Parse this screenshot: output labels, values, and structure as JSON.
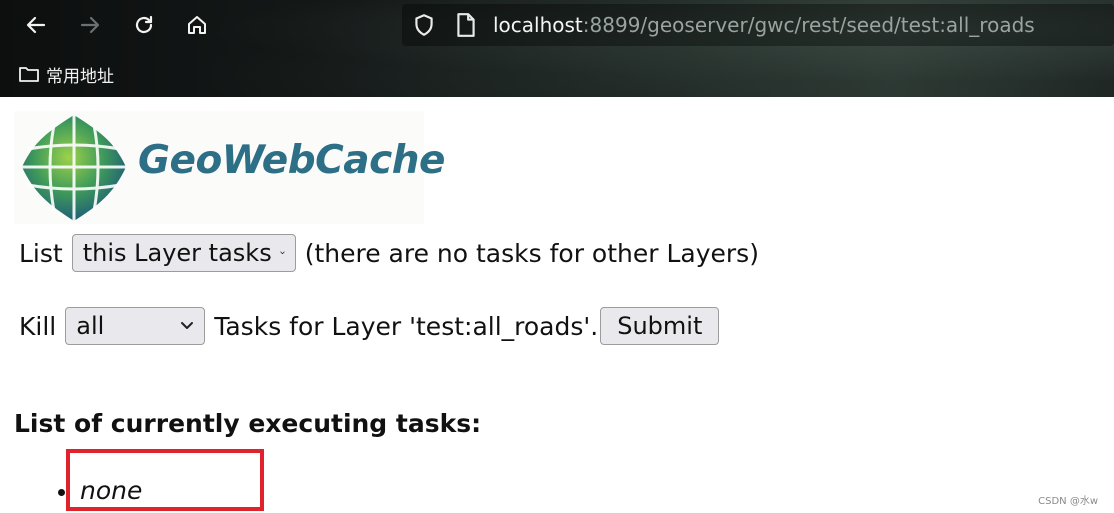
{
  "browser": {
    "url_host": "localhost",
    "url_rest": ":8899/geoserver/gwc/rest/seed/test:all_roads",
    "bookmark_folder": "常用地址",
    "icons": [
      "back-arrow-icon",
      "forward-arrow-icon",
      "reload-icon",
      "home-icon",
      "shield-icon",
      "page-icon",
      "folder-icon"
    ]
  },
  "logo": {
    "text": "GeoWebCache"
  },
  "list_row": {
    "label": "List",
    "select_value": "this Layer tasks",
    "note": "(there are no tasks for other Layers)"
  },
  "kill_row": {
    "label": "Kill",
    "select_value": "all",
    "text": "Tasks for Layer 'test:all_roads'.",
    "submit_label": "Submit"
  },
  "tasks": {
    "heading": "List of currently executing tasks:",
    "items": [
      "none"
    ]
  },
  "watermark": "CSDN @水w",
  "colors": {
    "logo_text": "#2c6f86",
    "highlight_box": "#e0222c"
  }
}
